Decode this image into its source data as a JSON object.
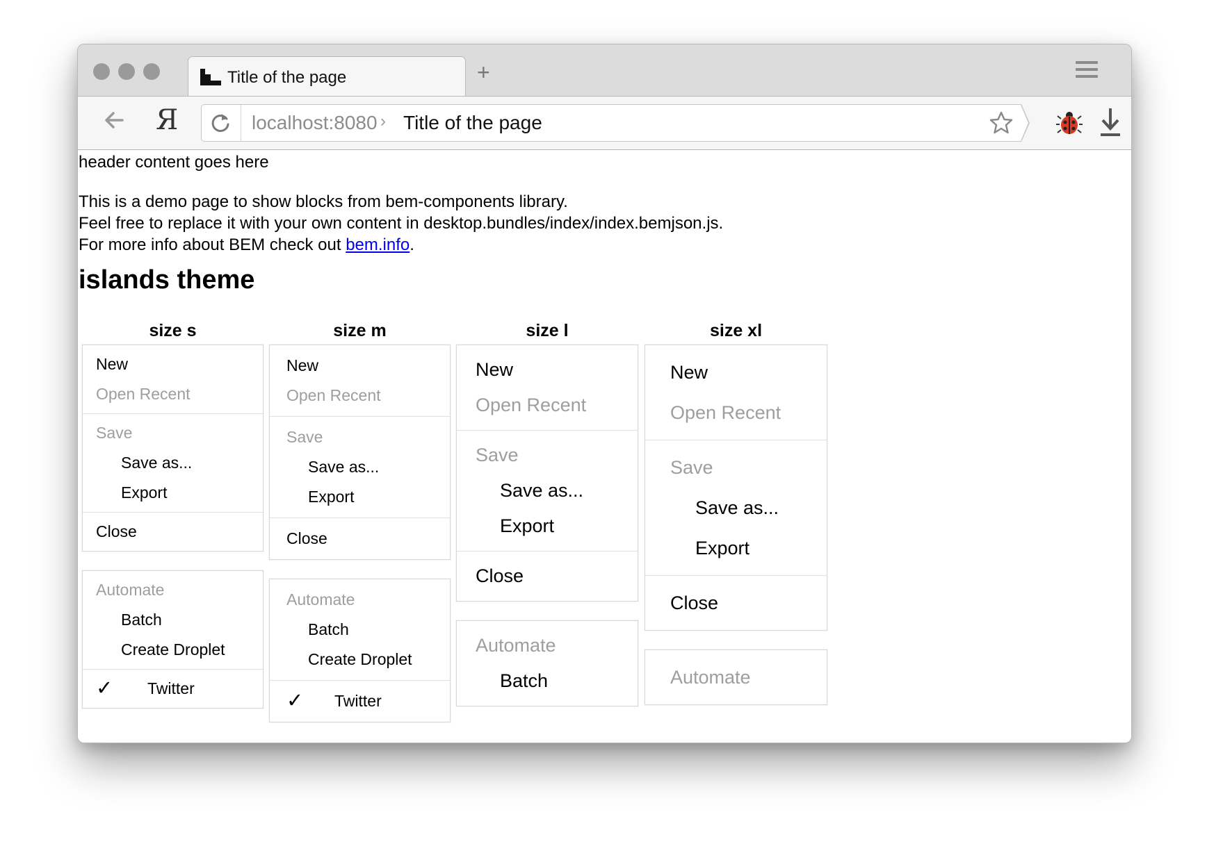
{
  "browser": {
    "tab_title": "Title of the page",
    "new_tab_symbol": "+",
    "address": {
      "host": "localhost:8080",
      "separator": "›",
      "page_title": "Title of the page"
    },
    "yandex_logo": "Я"
  },
  "page": {
    "header_text": "header content goes here",
    "intro": {
      "line1": "This is a demo page to show blocks from bem-components library.",
      "line2": "Feel free to replace it with your own content in desktop.bundles/index/index.bemjson.js.",
      "line3_prefix": "For more info about BEM check out ",
      "link_text": "bem.info",
      "line3_suffix": "."
    },
    "theme_title": "islands theme",
    "columns": [
      {
        "label": "size s",
        "menus": [
          {
            "groups": [
              [
                {
                  "label": "New",
                  "disabled": false
                },
                {
                  "label": "Open Recent",
                  "disabled": true
                }
              ],
              [
                {
                  "label": "Save",
                  "disabled": true
                },
                {
                  "label": "Save as...",
                  "disabled": false,
                  "indent": true
                },
                {
                  "label": "Export",
                  "disabled": false,
                  "indent": true
                }
              ],
              [
                {
                  "label": "Close",
                  "disabled": false
                }
              ]
            ]
          },
          {
            "groups": [
              [
                {
                  "label": "Automate",
                  "disabled": true
                },
                {
                  "label": "Batch",
                  "disabled": false,
                  "indent": true
                },
                {
                  "label": "Create Droplet",
                  "disabled": false,
                  "indent": true
                }
              ],
              [
                {
                  "label": "Twitter",
                  "disabled": false,
                  "checked": true,
                  "check_mark": "✓"
                }
              ]
            ]
          }
        ]
      },
      {
        "label": "size m",
        "menus": [
          {
            "groups": [
              [
                {
                  "label": "New",
                  "disabled": false
                },
                {
                  "label": "Open Recent",
                  "disabled": true
                }
              ],
              [
                {
                  "label": "Save",
                  "disabled": true
                },
                {
                  "label": "Save as...",
                  "disabled": false,
                  "indent": true
                },
                {
                  "label": "Export",
                  "disabled": false,
                  "indent": true
                }
              ],
              [
                {
                  "label": "Close",
                  "disabled": false
                }
              ]
            ]
          },
          {
            "groups": [
              [
                {
                  "label": "Automate",
                  "disabled": true
                },
                {
                  "label": "Batch",
                  "disabled": false,
                  "indent": true
                },
                {
                  "label": "Create Droplet",
                  "disabled": false,
                  "indent": true
                }
              ],
              [
                {
                  "label": "Twitter",
                  "disabled": false,
                  "checked": true,
                  "check_mark": "✓"
                }
              ]
            ]
          }
        ]
      },
      {
        "label": "size l",
        "menus": [
          {
            "groups": [
              [
                {
                  "label": "New",
                  "disabled": false
                },
                {
                  "label": "Open Recent",
                  "disabled": true
                }
              ],
              [
                {
                  "label": "Save",
                  "disabled": true
                },
                {
                  "label": "Save as...",
                  "disabled": false,
                  "indent": true
                },
                {
                  "label": "Export",
                  "disabled": false,
                  "indent": true
                }
              ],
              [
                {
                  "label": "Close",
                  "disabled": false
                }
              ]
            ]
          },
          {
            "groups": [
              [
                {
                  "label": "Automate",
                  "disabled": true
                },
                {
                  "label": "Batch",
                  "disabled": false,
                  "indent": true
                }
              ]
            ]
          }
        ]
      },
      {
        "label": "size xl",
        "menus": [
          {
            "groups": [
              [
                {
                  "label": "New",
                  "disabled": false
                },
                {
                  "label": "Open Recent",
                  "disabled": true
                }
              ],
              [
                {
                  "label": "Save",
                  "disabled": true
                },
                {
                  "label": "Save as...",
                  "disabled": false,
                  "indent": true
                },
                {
                  "label": "Export",
                  "disabled": false,
                  "indent": true
                }
              ],
              [
                {
                  "label": "Close",
                  "disabled": false
                }
              ]
            ]
          },
          {
            "groups": [
              [
                {
                  "label": "Automate",
                  "disabled": true
                }
              ]
            ]
          }
        ]
      }
    ]
  },
  "colors": {
    "link": "#0000ee",
    "disabled_text": "#9e9e9e",
    "chrome_bg": "#dcdcdc",
    "toolbar_bg": "#f6f6f6",
    "menu_border": "#d9d9d9"
  }
}
